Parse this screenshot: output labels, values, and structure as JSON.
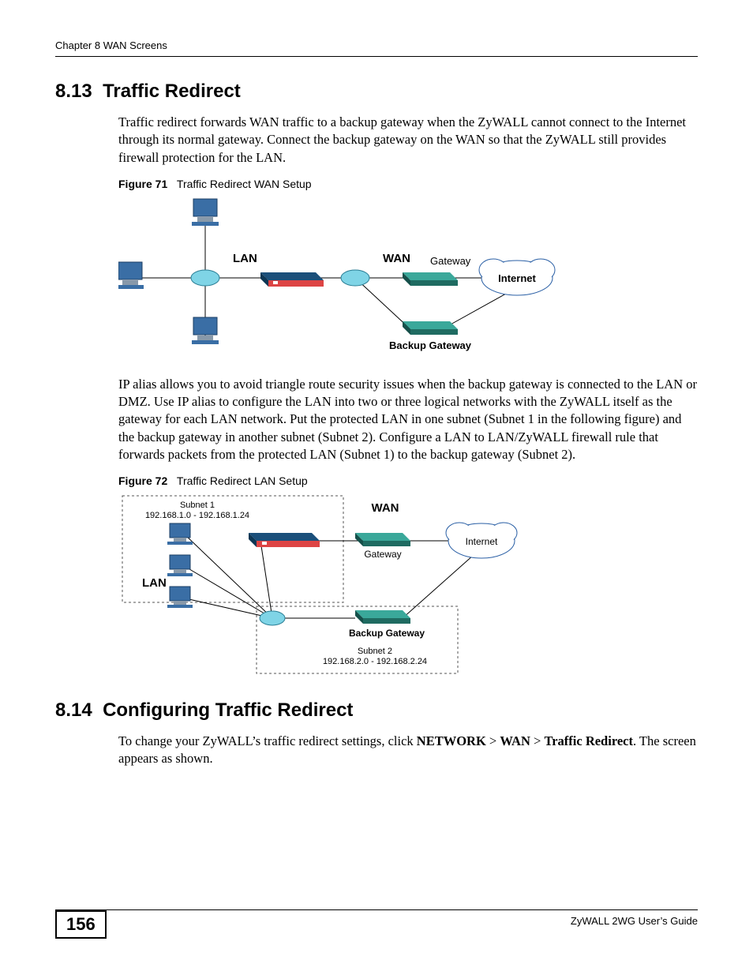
{
  "header": {
    "chapter": "Chapter 8 WAN Screens"
  },
  "section813": {
    "number": "8.13",
    "title": "Traffic Redirect",
    "para1": "Traffic redirect forwards WAN traffic to a backup gateway when the ZyWALL cannot connect to the Internet through its normal gateway. Connect the backup gateway on the WAN so that the ZyWALL still provides firewall protection for the LAN.",
    "para2": "IP alias allows you to avoid triangle route security issues when the backup gateway is connected to the LAN or DMZ. Use IP alias to configure the LAN into two or three logical networks with the ZyWALL itself as the gateway for each LAN network. Put the protected LAN in one subnet (Subnet 1 in the following figure) and the backup gateway in another subnet (Subnet 2). Configure a LAN to LAN/ZyWALL firewall rule that forwards packets from the protected LAN (Subnet 1) to the backup gateway (Subnet 2)."
  },
  "figure71": {
    "label": "Figure 71",
    "title": "Traffic Redirect WAN Setup",
    "labels": {
      "lan": "LAN",
      "wan": "WAN",
      "gateway": "Gateway",
      "internet": "Internet",
      "backup": "Backup Gateway"
    }
  },
  "figure72": {
    "label": "Figure 72",
    "title": "Traffic Redirect LAN Setup",
    "labels": {
      "subnet1_name": "Subnet 1",
      "subnet1_range": "192.168.1.0 - 192.168.1.24",
      "wan": "WAN",
      "internet": "Internet",
      "gateway": "Gateway",
      "lan": "LAN",
      "backup": "Backup Gateway",
      "subnet2_name": "Subnet 2",
      "subnet2_range": "192.168.2.0 - 192.168.2.24"
    }
  },
  "section814": {
    "number": "8.14",
    "title": "Configuring Traffic Redirect",
    "para1_pre": "To change your ZyWALL’s traffic redirect settings, click ",
    "nav1": "NETWORK",
    "sep": " > ",
    "nav2": "WAN",
    "nav3": "Traffic Redirect",
    "para1_post": ". The screen appears as shown."
  },
  "footer": {
    "page": "156",
    "guide": "ZyWALL 2WG User’s Guide"
  }
}
